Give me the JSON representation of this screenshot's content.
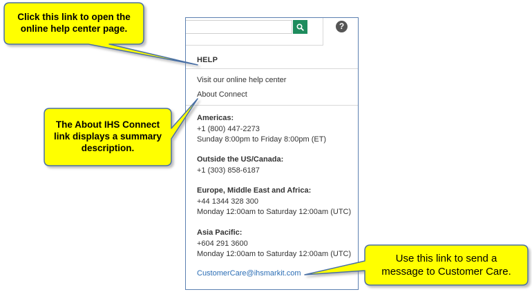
{
  "search": {
    "value": "",
    "placeholder": "",
    "button_icon": "search-icon"
  },
  "help_icon": {
    "glyph": "?",
    "icon": "question-circle-icon"
  },
  "help_menu": {
    "heading": "HELP",
    "links": [
      "Visit our online help center",
      "About Connect"
    ],
    "contacts": [
      {
        "region": "Americas:",
        "lines": [
          "+1 (800) 447-2273",
          "Sunday 8:00pm to Friday 8:00pm (ET)"
        ]
      },
      {
        "region": "Outside the US/Canada:",
        "lines": [
          "+1 (303) 858-6187"
        ]
      },
      {
        "region": "Europe, Middle East and Africa:",
        "lines": [
          "+44 1344 328 300",
          "Monday 12:00am to Saturday 12:00am (UTC)"
        ]
      },
      {
        "region": "Asia Pacific:",
        "lines": [
          "+604 291 3600",
          "Monday 12:00am to Saturday 12:00am (UTC)"
        ]
      }
    ],
    "email": "CustomerCare@ihsmarkit.com"
  },
  "callouts": [
    {
      "lines": [
        "Click this link to open the",
        "online help center page."
      ]
    },
    {
      "lines": [
        "The About IHS Connect",
        "link displays a summary",
        "description."
      ]
    },
    {
      "lines": [
        "Use this link to send a",
        "message to Customer Care."
      ]
    }
  ],
  "colors": {
    "accent_green": "#1e8c5d",
    "link_blue": "#2a6db5",
    "callout_fill": "#ffff00",
    "callout_border": "#4a6fa5",
    "panel_border": "#5b7fb0"
  }
}
